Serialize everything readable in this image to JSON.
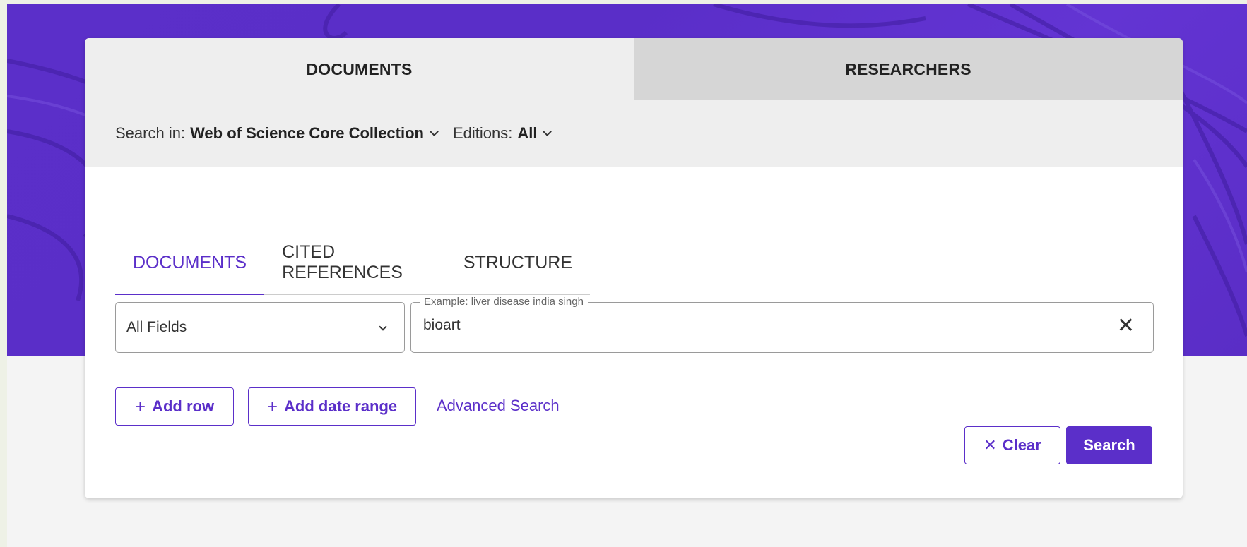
{
  "top_tabs": [
    {
      "label": "DOCUMENTS",
      "active": true
    },
    {
      "label": "RESEARCHERS",
      "active": false
    }
  ],
  "search_in": {
    "label": "Search in:",
    "collection": "Web of Science Core Collection",
    "editions_label": "Editions:",
    "editions_value": "All"
  },
  "sub_tabs": [
    {
      "label": "DOCUMENTS",
      "active": true
    },
    {
      "label": "CITED REFERENCES",
      "active": false
    },
    {
      "label": "STRUCTURE",
      "active": false
    }
  ],
  "query_row": {
    "field_selected": "All Fields",
    "placeholder_example": "Example: liver disease india singh",
    "value": "bioart"
  },
  "actions": {
    "add_row": "Add row",
    "add_date_range": "Add date range",
    "advanced_search": "Advanced Search",
    "clear": "Clear",
    "search": "Search"
  },
  "colors": {
    "brand": "#5b2fc9",
    "hero_bg": "#5a2ec8",
    "page_bg": "#f4f4f4"
  }
}
